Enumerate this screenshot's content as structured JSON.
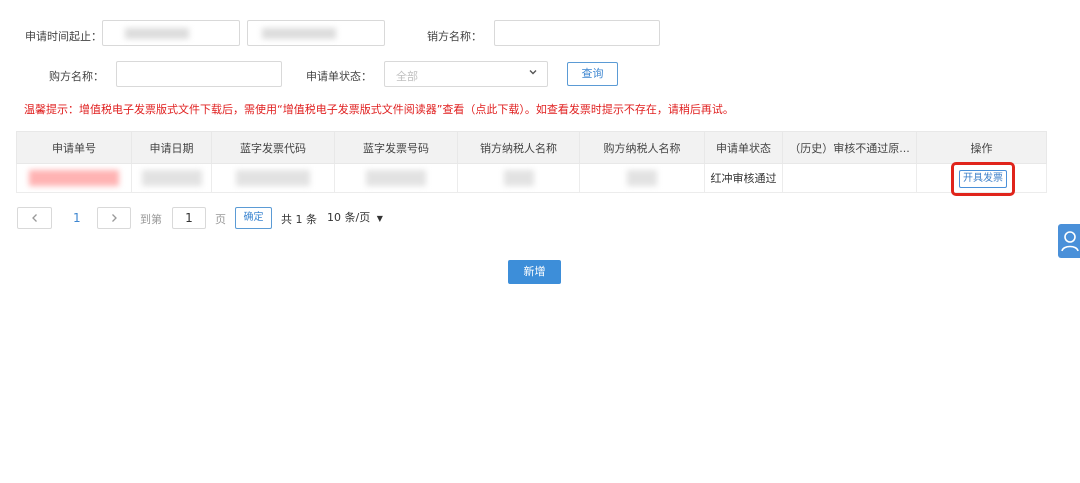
{
  "filters": {
    "apply_time_label": "申请时间起止：",
    "seller_label": "销方名称：",
    "buyer_label": "购方名称：",
    "status_label": "申请单状态：",
    "status_placeholder": "全部",
    "query_button": "查询"
  },
  "warning_text": "温馨提示：增值税电子发票版式文件下载后，需使用“增值税电子发票版式文件阅读器”查看（点此下载）。如查看发票时提示不存在，请稍后再试。",
  "table": {
    "headers": [
      "申请单号",
      "申请日期",
      "蓝字发票代码",
      "蓝字发票号码",
      "销方纳税人名称",
      "购方纳税人名称",
      "申请单状态",
      "（历史）审核不通过原...",
      "操作"
    ],
    "row": {
      "status": "红冲审核通过",
      "reason": "",
      "action_button": "开具发票"
    }
  },
  "pagination": {
    "current_page": "1",
    "goto_label": "到第",
    "goto_value": "1",
    "page_unit": "页",
    "confirm_button": "确定",
    "total_text": "共 1 条",
    "page_size": "10 条/页",
    "prev_icon": "chevron-left-icon",
    "next_icon": "chevron-right-icon"
  },
  "add_button": "新增",
  "colors": {
    "accent": "#3d8ed9",
    "warning": "#e02020",
    "highlight": "#e0241b"
  }
}
